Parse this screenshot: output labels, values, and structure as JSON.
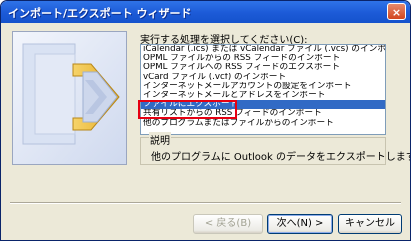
{
  "window": {
    "title": "インポート/エクスポート ウィザード",
    "close_glyph": "×"
  },
  "prompt_label": "実行する処理を選択してください(C):",
  "list": {
    "items": [
      "iCalendar (.ics) または vCalendar ファイル (.vcs) のインポート",
      "OPML ファイルからの RSS フィードのインポート",
      "OPML ファイルへの RSS フィードのエクスポート",
      "vCard ファイル (.vcf) のインポート",
      "インターネットメールアカウントの設定をインポート",
      "インターネットメールとアドレスをインポート",
      "ファイルにエクスポート",
      "共有リストからの RSS フィードのインポート",
      "他のプログラムまたはファイルからのインポート"
    ],
    "selected_index": 6
  },
  "description": {
    "legend": "説明",
    "text": "他のプログラムに Outlook のデータをエクスポートします。"
  },
  "buttons": {
    "back": "< 戻る(B)",
    "next": "次へ(N) >",
    "cancel": "キャンセル"
  },
  "colors": {
    "titlebar": "#1c5ad7",
    "selection": "#316ac5",
    "highlight_box": "#e60012",
    "dialog_face": "#ece9d8"
  }
}
